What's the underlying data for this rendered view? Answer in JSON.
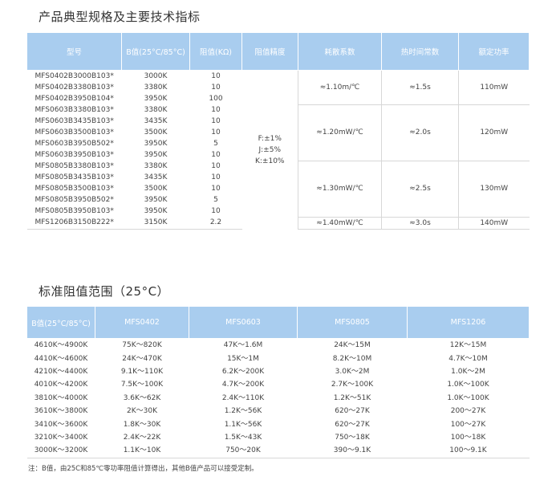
{
  "section1_title": "产品典型规格及主要技术指标",
  "section2_title": "标准阻值范围（25°C）",
  "spec_table": {
    "headers": [
      "型号",
      "B值(25°C/85°C)",
      "阻值(KΩ)",
      "阻值精度",
      "耗散系数",
      "热时间常数",
      "额定功率"
    ],
    "rows": [
      [
        "MFS0402B3000B103*",
        "3000K",
        "10"
      ],
      [
        "MFS0402B3380B103*",
        "3380K",
        "10"
      ],
      [
        "MFS0402B3950B104*",
        "3950K",
        "100"
      ],
      [
        "MFS0603B3380B103*",
        "3380K",
        "10"
      ],
      [
        "MFS0603B3435B103*",
        "3435K",
        "10"
      ],
      [
        "MFS0603B3500B103*",
        "3500K",
        "10"
      ],
      [
        "MFS0603B3950B502*",
        "3950K",
        "5"
      ],
      [
        "MFS0603B3950B103*",
        "3950K",
        "10"
      ],
      [
        "MFS0805B3380B103*",
        "3380K",
        "10"
      ],
      [
        "MFS0805B3435B103*",
        "3435K",
        "10"
      ],
      [
        "MFS0805B3500B103*",
        "3500K",
        "10"
      ],
      [
        "MFS0805B3950B502*",
        "3950K",
        "5"
      ],
      [
        "MFS0805B3950B103*",
        "3950K",
        "10"
      ],
      [
        "MFS1206B3150B222*",
        "3150K",
        "2.2"
      ]
    ],
    "precision": "F:±1%\nJ:±5%\nK:±10%",
    "groups": [
      {
        "dissipation": "≈1.10m/℃",
        "time_constant": "≈1.5s",
        "power": "110mW"
      },
      {
        "dissipation": "≈1.20mW/℃",
        "time_constant": "≈2.0s",
        "power": "120mW"
      },
      {
        "dissipation": "≈1.30mW/℃",
        "time_constant": "≈2.5s",
        "power": "130mW"
      },
      {
        "dissipation": "≈1.40mW/℃",
        "time_constant": "≈3.0s",
        "power": "140mW"
      }
    ]
  },
  "resistance_table": {
    "headers": [
      "B值(25°C/85°C)",
      "MFS0402",
      "MFS0603",
      "MFS0805",
      "MFS1206"
    ],
    "rows": [
      [
        "4610K～4900K",
        "75K～820K",
        "47K～1.6M",
        "24K～15M",
        "12K～15M"
      ],
      [
        "4410K～4600K",
        "24K～470K",
        "15K～1M",
        "8.2K～10M",
        "4.7K～10M"
      ],
      [
        "4210K～4400K",
        "9.1K～110K",
        "6.2K～200K",
        "3.0K～2M",
        "1.0K～2M"
      ],
      [
        "4010K～4200K",
        "7.5K～100K",
        "4.7K～200K",
        "2.7K～100K",
        "1.0K～100K"
      ],
      [
        "3810K～4000K",
        "3.6K～62K",
        "2.4K～110K",
        "1.2K～51K",
        "1.0K～100K"
      ],
      [
        "3610K～3800K",
        "2K～30K",
        "1.2K～56K",
        "620～27K",
        "200～27K"
      ],
      [
        "3410K～3600K",
        "1.8K～30K",
        "1.1K～56K",
        "620～27K",
        "100～27K"
      ],
      [
        "3210K～3400K",
        "2.4K～22K",
        "1.5K～43K",
        "750～18K",
        "100～18K"
      ],
      [
        "3000K～3200K",
        "1.1K～10K",
        "750～20K",
        "390～9.1K",
        "100～9.1K"
      ]
    ]
  },
  "note": "注：B值，由25C和85℃零功率阻值计算得出，其他B值产品可以接受定制。",
  "colors": {
    "header_bg": "#a9cdef",
    "header_text": "#ffffff",
    "border": "#d7d7d7"
  }
}
